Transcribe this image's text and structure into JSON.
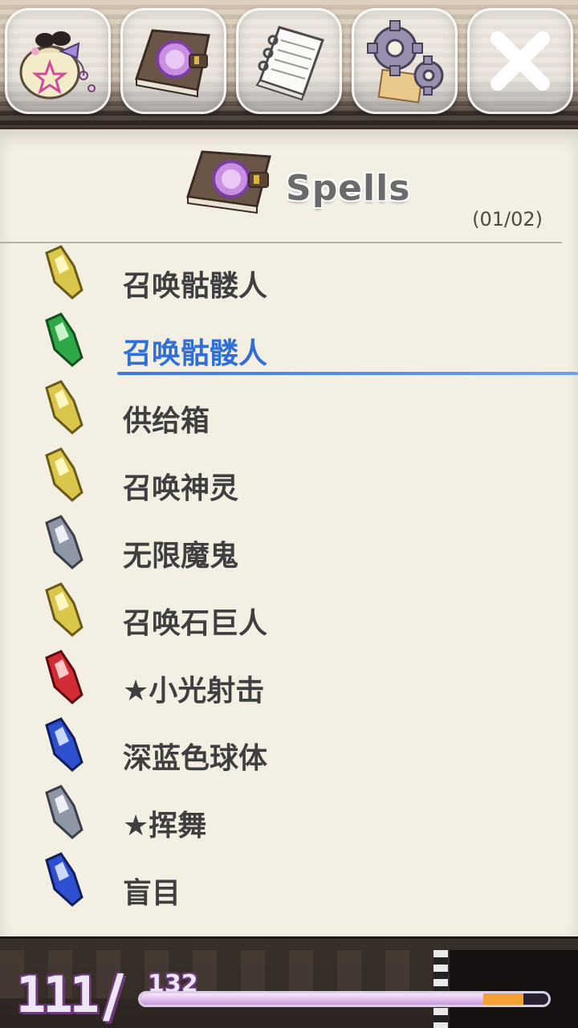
{
  "panel": {
    "title": "Spells",
    "page_indicator": "(01/02)"
  },
  "spells": [
    {
      "label": "召唤骷髅人",
      "gem": "yellow",
      "selected": false
    },
    {
      "label": "召唤骷髅人",
      "gem": "green",
      "selected": true
    },
    {
      "label": "供给箱",
      "gem": "yellow",
      "selected": false
    },
    {
      "label": "召唤神灵",
      "gem": "yellow",
      "selected": false
    },
    {
      "label": "无限魔鬼",
      "gem": "silver",
      "selected": false
    },
    {
      "label": "召唤石巨人",
      "gem": "yellow",
      "selected": false
    },
    {
      "label": "★小光射击",
      "gem": "red",
      "selected": false
    },
    {
      "label": "深蓝色球体",
      "gem": "blue",
      "selected": false
    },
    {
      "label": "★挥舞",
      "gem": "silver",
      "selected": false
    },
    {
      "label": "盲目",
      "gem": "blue",
      "selected": false
    }
  ],
  "tabs": [
    {
      "icon": "pouch-icon"
    },
    {
      "icon": "spellbook-icon"
    },
    {
      "icon": "notebook-icon"
    },
    {
      "icon": "gear-icon"
    },
    {
      "icon": "close-icon"
    }
  ],
  "hp": {
    "current": "111",
    "slash": "/",
    "max": "132",
    "fraction": 0.8409
  },
  "colors": {
    "selected_text": "#2f6fd6",
    "gem_yellow": "#d9c64a",
    "gem_green": "#2fa84a",
    "gem_silver": "#8f97a6",
    "gem_red": "#d12c34",
    "gem_blue": "#2e4fd0",
    "hp_fill": "#f2a132"
  }
}
